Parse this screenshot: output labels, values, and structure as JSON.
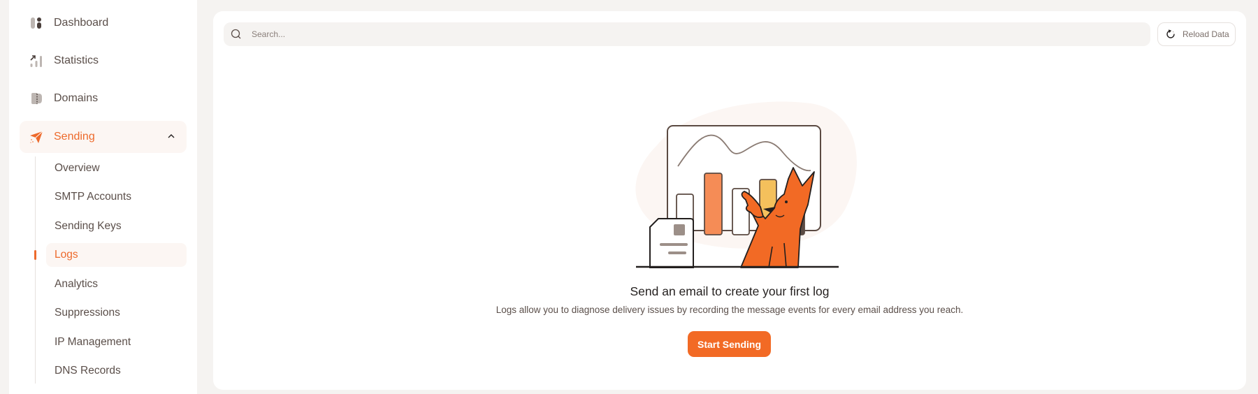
{
  "sidebar": {
    "items": [
      {
        "label": "Dashboard",
        "icon": "dashboard-icon"
      },
      {
        "label": "Statistics",
        "icon": "statistics-icon"
      },
      {
        "label": "Domains",
        "icon": "domains-icon"
      },
      {
        "label": "Sending",
        "icon": "paper-plane-icon",
        "expanded": true
      }
    ],
    "sending_sub": [
      {
        "label": "Overview"
      },
      {
        "label": "SMTP Accounts"
      },
      {
        "label": "Sending Keys"
      },
      {
        "label": "Logs",
        "active": true
      },
      {
        "label": "Analytics"
      },
      {
        "label": "Suppressions"
      },
      {
        "label": "IP Management"
      },
      {
        "label": "DNS Records"
      }
    ]
  },
  "toolbar": {
    "search_placeholder": "Search...",
    "search_value": "",
    "reload_label": "Reload Data"
  },
  "empty_state": {
    "title": "Send an email to create your first log",
    "description": "Logs allow you to diagnose delivery issues by recording the message events for every email address you reach.",
    "cta_label": "Start Sending"
  },
  "colors": {
    "accent": "#f26a25",
    "active_bg": "#fcf6f3",
    "page_bg": "#f5f3f1",
    "text": "#5b4f4a"
  }
}
